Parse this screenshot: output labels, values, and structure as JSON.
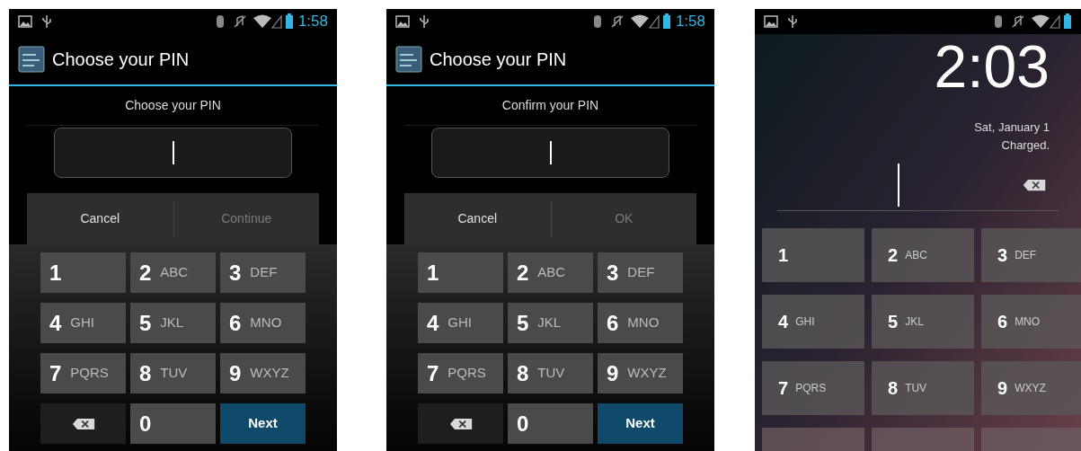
{
  "phones": [
    {
      "kind": "setup",
      "status_bar": {
        "time": "1:58"
      },
      "title": "Choose your PIN",
      "prompt": "Choose your PIN",
      "buttons": [
        {
          "label": "Cancel",
          "disabled": false
        },
        {
          "label": "Continue",
          "disabled": true
        }
      ],
      "keys": [
        {
          "kind": "digit",
          "digit": "1"
        },
        {
          "kind": "digit",
          "digit": "2",
          "letters": "ABC"
        },
        {
          "kind": "digit",
          "digit": "3",
          "letters": "DEF"
        },
        {
          "kind": "digit",
          "digit": "4",
          "letters": "GHI"
        },
        {
          "kind": "digit",
          "digit": "5",
          "letters": "JKL"
        },
        {
          "kind": "digit",
          "digit": "6",
          "letters": "MNO"
        },
        {
          "kind": "digit",
          "digit": "7",
          "letters": "PQRS"
        },
        {
          "kind": "digit",
          "digit": "8",
          "letters": "TUV"
        },
        {
          "kind": "digit",
          "digit": "9",
          "letters": "WXYZ"
        },
        {
          "kind": "delete"
        },
        {
          "kind": "digit",
          "digit": "0"
        },
        {
          "kind": "next",
          "label": "Next"
        }
      ]
    },
    {
      "kind": "setup",
      "status_bar": {
        "time": "1:58"
      },
      "title": "Choose your PIN",
      "prompt": "Confirm your PIN",
      "buttons": [
        {
          "label": "Cancel",
          "disabled": false
        },
        {
          "label": "OK",
          "disabled": true
        }
      ],
      "keys": [
        {
          "kind": "digit",
          "digit": "1"
        },
        {
          "kind": "digit",
          "digit": "2",
          "letters": "ABC"
        },
        {
          "kind": "digit",
          "digit": "3",
          "letters": "DEF"
        },
        {
          "kind": "digit",
          "digit": "4",
          "letters": "GHI"
        },
        {
          "kind": "digit",
          "digit": "5",
          "letters": "JKL"
        },
        {
          "kind": "digit",
          "digit": "6",
          "letters": "MNO"
        },
        {
          "kind": "digit",
          "digit": "7",
          "letters": "PQRS"
        },
        {
          "kind": "digit",
          "digit": "8",
          "letters": "TUV"
        },
        {
          "kind": "digit",
          "digit": "9",
          "letters": "WXYZ"
        },
        {
          "kind": "delete"
        },
        {
          "kind": "digit",
          "digit": "0"
        },
        {
          "kind": "next",
          "label": "Next"
        }
      ]
    },
    {
      "kind": "lockscreen",
      "clock": "2:03",
      "date": "Sat, January 1",
      "status": "Charged.",
      "keys": [
        {
          "kind": "digit",
          "digit": "1"
        },
        {
          "kind": "digit",
          "digit": "2",
          "letters": "ABC"
        },
        {
          "kind": "digit",
          "digit": "3",
          "letters": "DEF"
        },
        {
          "kind": "digit",
          "digit": "4",
          "letters": "GHI"
        },
        {
          "kind": "digit",
          "digit": "5",
          "letters": "JKL"
        },
        {
          "kind": "digit",
          "digit": "6",
          "letters": "MNO"
        },
        {
          "kind": "digit",
          "digit": "7",
          "letters": "PQRS"
        },
        {
          "kind": "digit",
          "digit": "8",
          "letters": "TUV"
        },
        {
          "kind": "digit",
          "digit": "9",
          "letters": "WXYZ"
        },
        {
          "kind": "blank"
        },
        {
          "kind": "blank"
        },
        {
          "kind": "blank"
        }
      ]
    }
  ]
}
